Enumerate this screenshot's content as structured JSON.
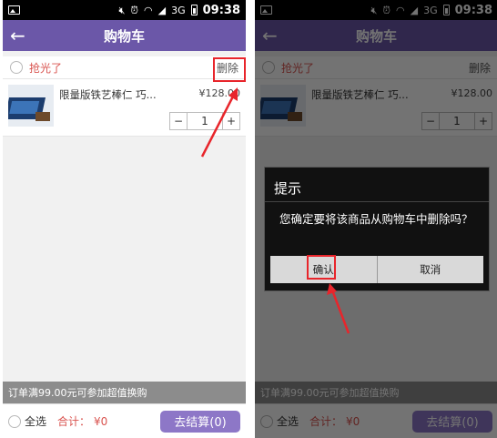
{
  "status_bar": {
    "time": "09:38",
    "network": "3G"
  },
  "cart": {
    "title": "购物车",
    "shop_name": "抢光了",
    "delete_label": "删除",
    "item": {
      "name": "限量版铁艺棒仁 巧...",
      "price": "¥128.00",
      "quantity": "1"
    },
    "minus_label": "−",
    "plus_label": "+"
  },
  "promo_text": "订单满99.00元可参加超值换购",
  "bottom_bar": {
    "select_all": "全选",
    "total_label": "合计：",
    "total_amount": "¥0",
    "checkout_label": "去结算(0)"
  },
  "dialog": {
    "title": "提示",
    "message": "您确定要将该商品从购物车中删除吗？",
    "confirm_label": "确认",
    "cancel_label": "取消"
  },
  "colors": {
    "header": "#6b57a8",
    "accent_red": "#d9534f",
    "annotation": "#e8252b",
    "checkout": "#8d77c7"
  }
}
